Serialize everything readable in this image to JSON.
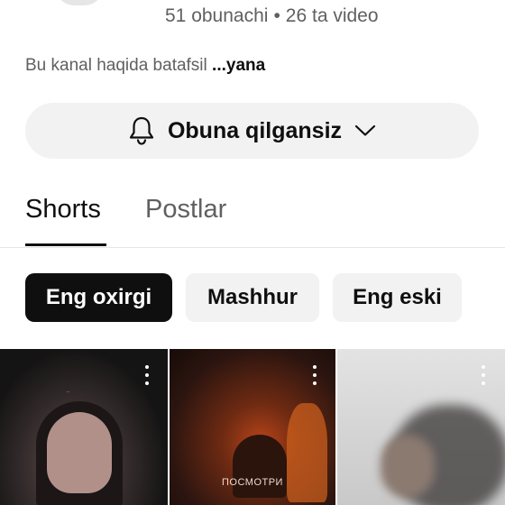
{
  "channel": {
    "subscribers": "51 obunachi",
    "separator": "•",
    "videos": "26 ta video",
    "about": "Bu kanal haqida batafsil",
    "more": "...yana",
    "subscribe_label": "Obuna qilgansiz"
  },
  "tabs": [
    {
      "label": "Shorts",
      "active": true
    },
    {
      "label": "Postlar",
      "active": false
    }
  ],
  "chips": [
    {
      "label": "Eng oxirgi",
      "selected": true
    },
    {
      "label": "Mashhur",
      "selected": false
    },
    {
      "label": "Eng eski",
      "selected": false
    }
  ],
  "thumbnails": [
    {
      "overlay_text": "_"
    },
    {
      "overlay_text": "ПОСМОТРИ"
    },
    {
      "overlay_text": ""
    }
  ],
  "icons": {
    "bell": "bell-icon",
    "chevron": "chevron-down-icon",
    "more": "more-vert-icon"
  },
  "colors": {
    "chip_selected_bg": "#0f0f0f",
    "chip_bg": "#f2f2f2",
    "secondary_text": "#606060"
  }
}
